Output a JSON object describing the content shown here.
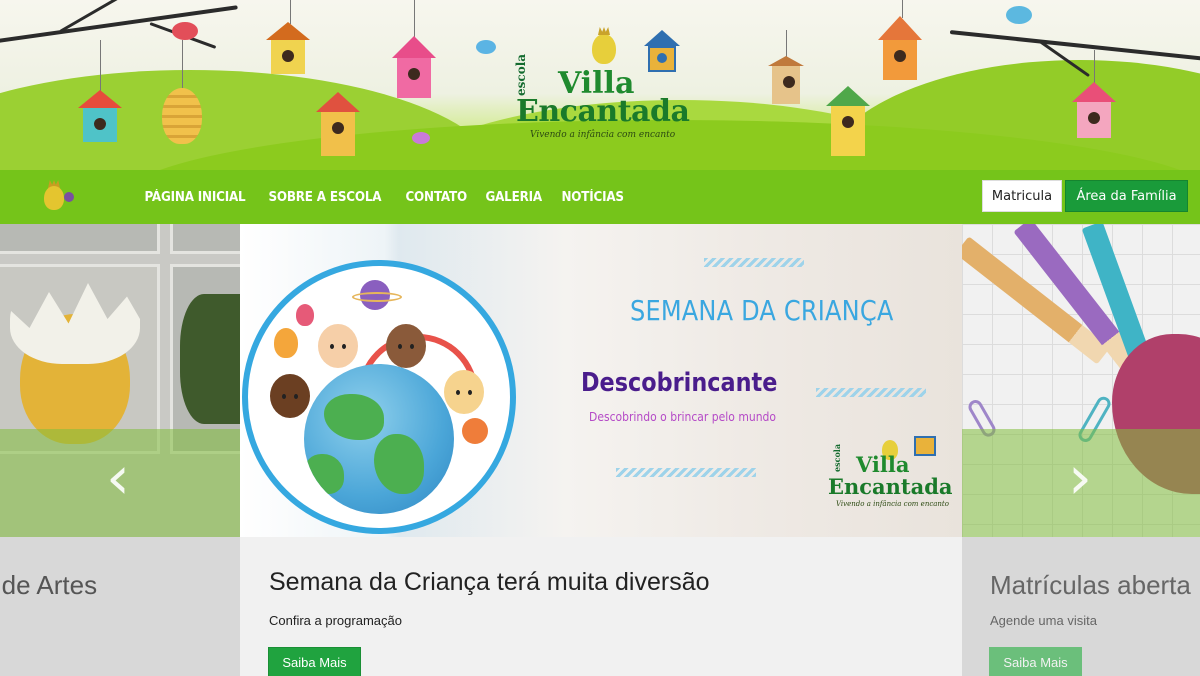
{
  "header": {
    "logo": {
      "escola": "escola",
      "villa": "Villa",
      "encantada": "Encantada",
      "tagline": "Vivendo a infância com encanto"
    }
  },
  "nav": {
    "items": [
      {
        "label": "PÁGINA INICIAL"
      },
      {
        "label": "SOBRE A ESCOLA"
      },
      {
        "label": "CONTATO"
      },
      {
        "label": "GALERIA"
      },
      {
        "label": "NOTÍCIAS"
      }
    ],
    "matricula_label": "Matricula",
    "familia_label": "Área da Família"
  },
  "slider": {
    "prev_icon": "chevron-left-icon",
    "next_icon": "chevron-right-icon",
    "prev_glyph": "‹",
    "next_glyph": "›",
    "slides": [
      {
        "title": "a de Artes"
      },
      {
        "title": "Semana da Criança terá muita diversão",
        "subtitle": "Confira a programação",
        "button": "Saiba Mais",
        "banner": {
          "heading": "SEMANA DA CRIANÇA",
          "name": "Descobrincante",
          "tagline": "Descobrindo o brincar pelo mundo",
          "logo_escola": "escola",
          "logo_villa": "Villa",
          "logo_encantada": "Encantada",
          "logo_tagline": "Vivendo a infância com encanto"
        }
      },
      {
        "title": "Matrículas aberta",
        "subtitle": "Agende uma visita",
        "button": "Saiba Mais"
      }
    ]
  },
  "colors": {
    "nav_green": "#75c41a",
    "button_green": "#1a9b3a",
    "accent_blue": "#3aa7e0",
    "accent_purple": "#4a1d8c"
  }
}
